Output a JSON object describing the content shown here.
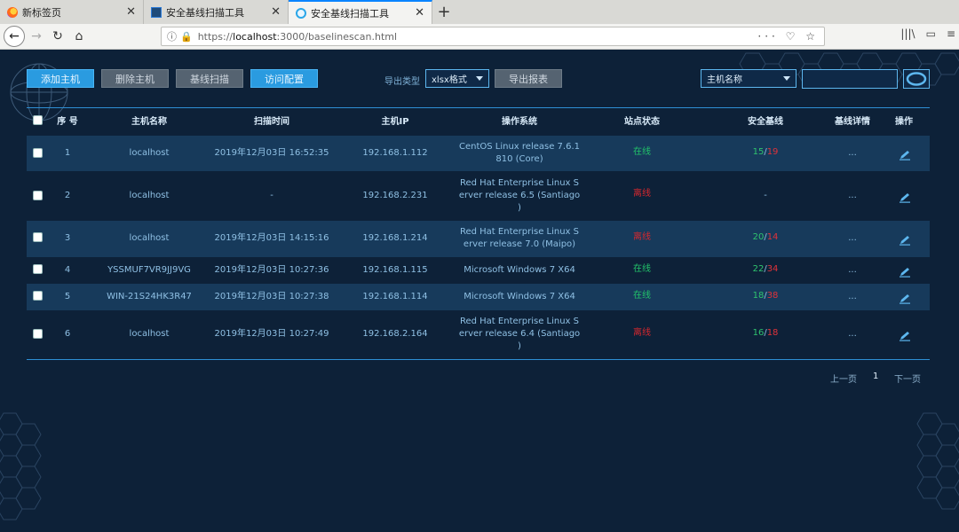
{
  "browser": {
    "tabs": [
      {
        "title": "新标签页",
        "icon": "firefox-icon"
      },
      {
        "title": "安全基线扫描工具",
        "icon": "tool-icon"
      },
      {
        "title": "安全基线扫描工具",
        "icon": "tool-icon-active",
        "active": true
      }
    ],
    "url_prefix": "https://",
    "url_host": "localhost",
    "url_rest": ":3000/baselinescan.html",
    "url_right": "··· ♡ ☆"
  },
  "toolbar": {
    "add_host": "添加主机",
    "delete_host": "删除主机",
    "baseline_scan": "基线扫描",
    "access_config": "访问配置",
    "export_type_label": "导出类型",
    "export_format": "xlsx格式",
    "export_report": "导出报表",
    "search_field": "主机名称",
    "search_value": ""
  },
  "table": {
    "headers": {
      "index": "序 号",
      "hostname": "主机名称",
      "scan_time": "扫描时间",
      "ip": "主机IP",
      "os": "操作系统",
      "status": "站点状态",
      "baseline": "安全基线",
      "detail": "基线详情",
      "action": "操作"
    },
    "rows": [
      {
        "index": "1",
        "hostname": "localhost",
        "scan_time": "2019年12月03日 16:52:35",
        "ip": "192.168.1.112",
        "os_lines": [
          "CentOS Linux release 7.6.1",
          "810 (Core)"
        ],
        "status": "在线",
        "pass": "15",
        "fail": "19",
        "detail": "..."
      },
      {
        "index": "2",
        "hostname": "localhost",
        "scan_time": "-",
        "ip": "192.168.2.231",
        "os_lines": [
          "Red Hat Enterprise Linux S",
          "erver release 6.5 (Santiago",
          ")"
        ],
        "status": "离线",
        "baseline_text": "-",
        "detail": "..."
      },
      {
        "index": "3",
        "hostname": "localhost",
        "scan_time": "2019年12月03日 14:15:16",
        "ip": "192.168.1.214",
        "os_lines": [
          "Red Hat Enterprise Linux S",
          "erver release 7.0 (Maipo)"
        ],
        "status": "离线",
        "pass": "20",
        "fail": "14",
        "detail": "..."
      },
      {
        "index": "4",
        "hostname": "YSSMUF7VR9JJ9VG",
        "scan_time": "2019年12月03日 10:27:36",
        "ip": "192.168.1.115",
        "os_lines": [
          "Microsoft Windows 7 X64"
        ],
        "status": "在线",
        "pass": "22",
        "fail": "34",
        "detail": "..."
      },
      {
        "index": "5",
        "hostname": "WIN-21S24HK3R47",
        "scan_time": "2019年12月03日 10:27:38",
        "ip": "192.168.1.114",
        "os_lines": [
          "Microsoft Windows 7 X64"
        ],
        "status": "在线",
        "pass": "18",
        "fail": "38",
        "detail": "..."
      },
      {
        "index": "6",
        "hostname": "localhost",
        "scan_time": "2019年12月03日 10:27:49",
        "ip": "192.168.2.164",
        "os_lines": [
          "Red Hat Enterprise Linux S",
          "erver release 6.4 (Santiago",
          ")"
        ],
        "status": "离线",
        "pass": "16",
        "fail": "18",
        "detail": "..."
      }
    ]
  },
  "pagination": {
    "prev": "上一页",
    "current": "1",
    "next": "下一页"
  },
  "colors": {
    "online": "#22c36a",
    "offline": "#d9282e",
    "accent": "#2a9be0",
    "background": "#0d2138"
  }
}
